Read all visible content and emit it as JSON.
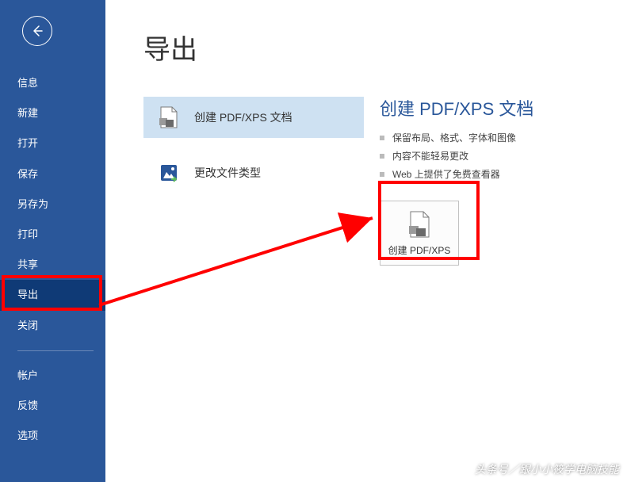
{
  "sidebar": {
    "items": [
      {
        "label": "信息"
      },
      {
        "label": "新建"
      },
      {
        "label": "打开"
      },
      {
        "label": "保存"
      },
      {
        "label": "另存为"
      },
      {
        "label": "打印"
      },
      {
        "label": "共享"
      },
      {
        "label": "导出"
      },
      {
        "label": "关闭"
      }
    ],
    "bottom_items": [
      {
        "label": "帐户"
      },
      {
        "label": "反馈"
      },
      {
        "label": "选项"
      }
    ]
  },
  "page": {
    "title": "导出"
  },
  "export": {
    "items": [
      {
        "label": "创建 PDF/XPS 文档",
        "icon": "pdf-doc-icon"
      },
      {
        "label": "更改文件类型",
        "icon": "change-type-icon"
      }
    ]
  },
  "detail": {
    "title": "创建 PDF/XPS 文档",
    "points": [
      "保留布局、格式、字体和图像",
      "内容不能轻易更改",
      "Web 上提供了免费查看器"
    ],
    "button_label": "创建 PDF/XPS"
  },
  "watermark": "头条号／跟小小筱学电脑技能"
}
